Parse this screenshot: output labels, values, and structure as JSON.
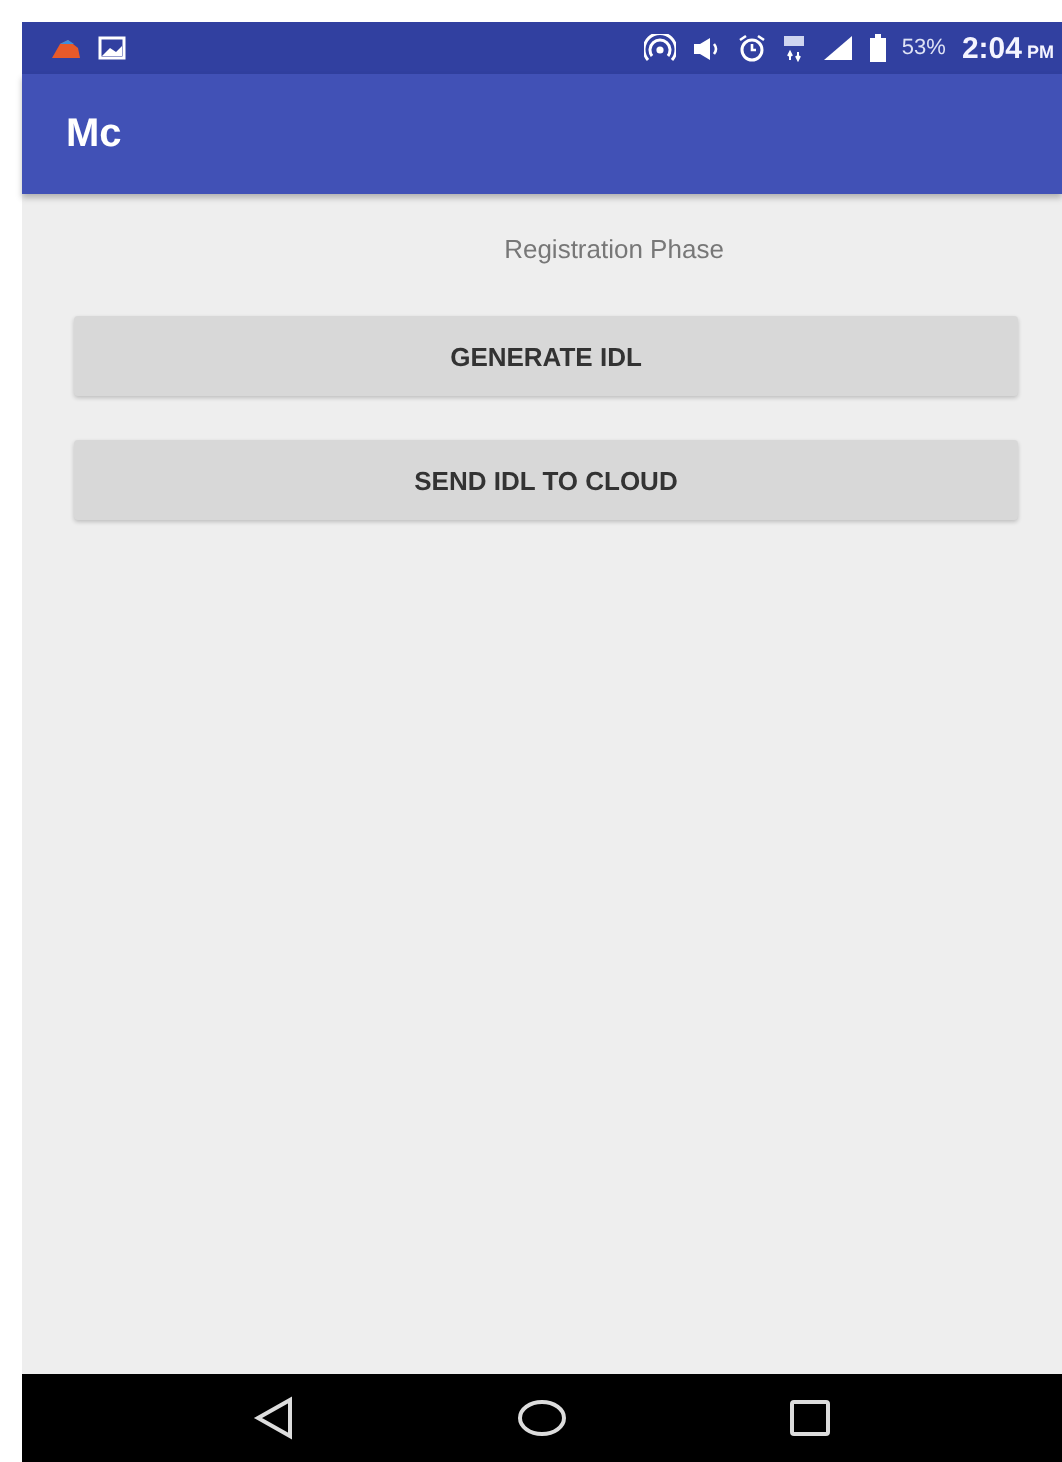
{
  "status_bar": {
    "battery": "53%",
    "time": "2:04",
    "meridiem": "PM"
  },
  "app_bar": {
    "title": "Mc"
  },
  "heading": "Registration Phase",
  "buttons": [
    "GENERATE IDL",
    "SEND IDL TO CLOUD"
  ]
}
